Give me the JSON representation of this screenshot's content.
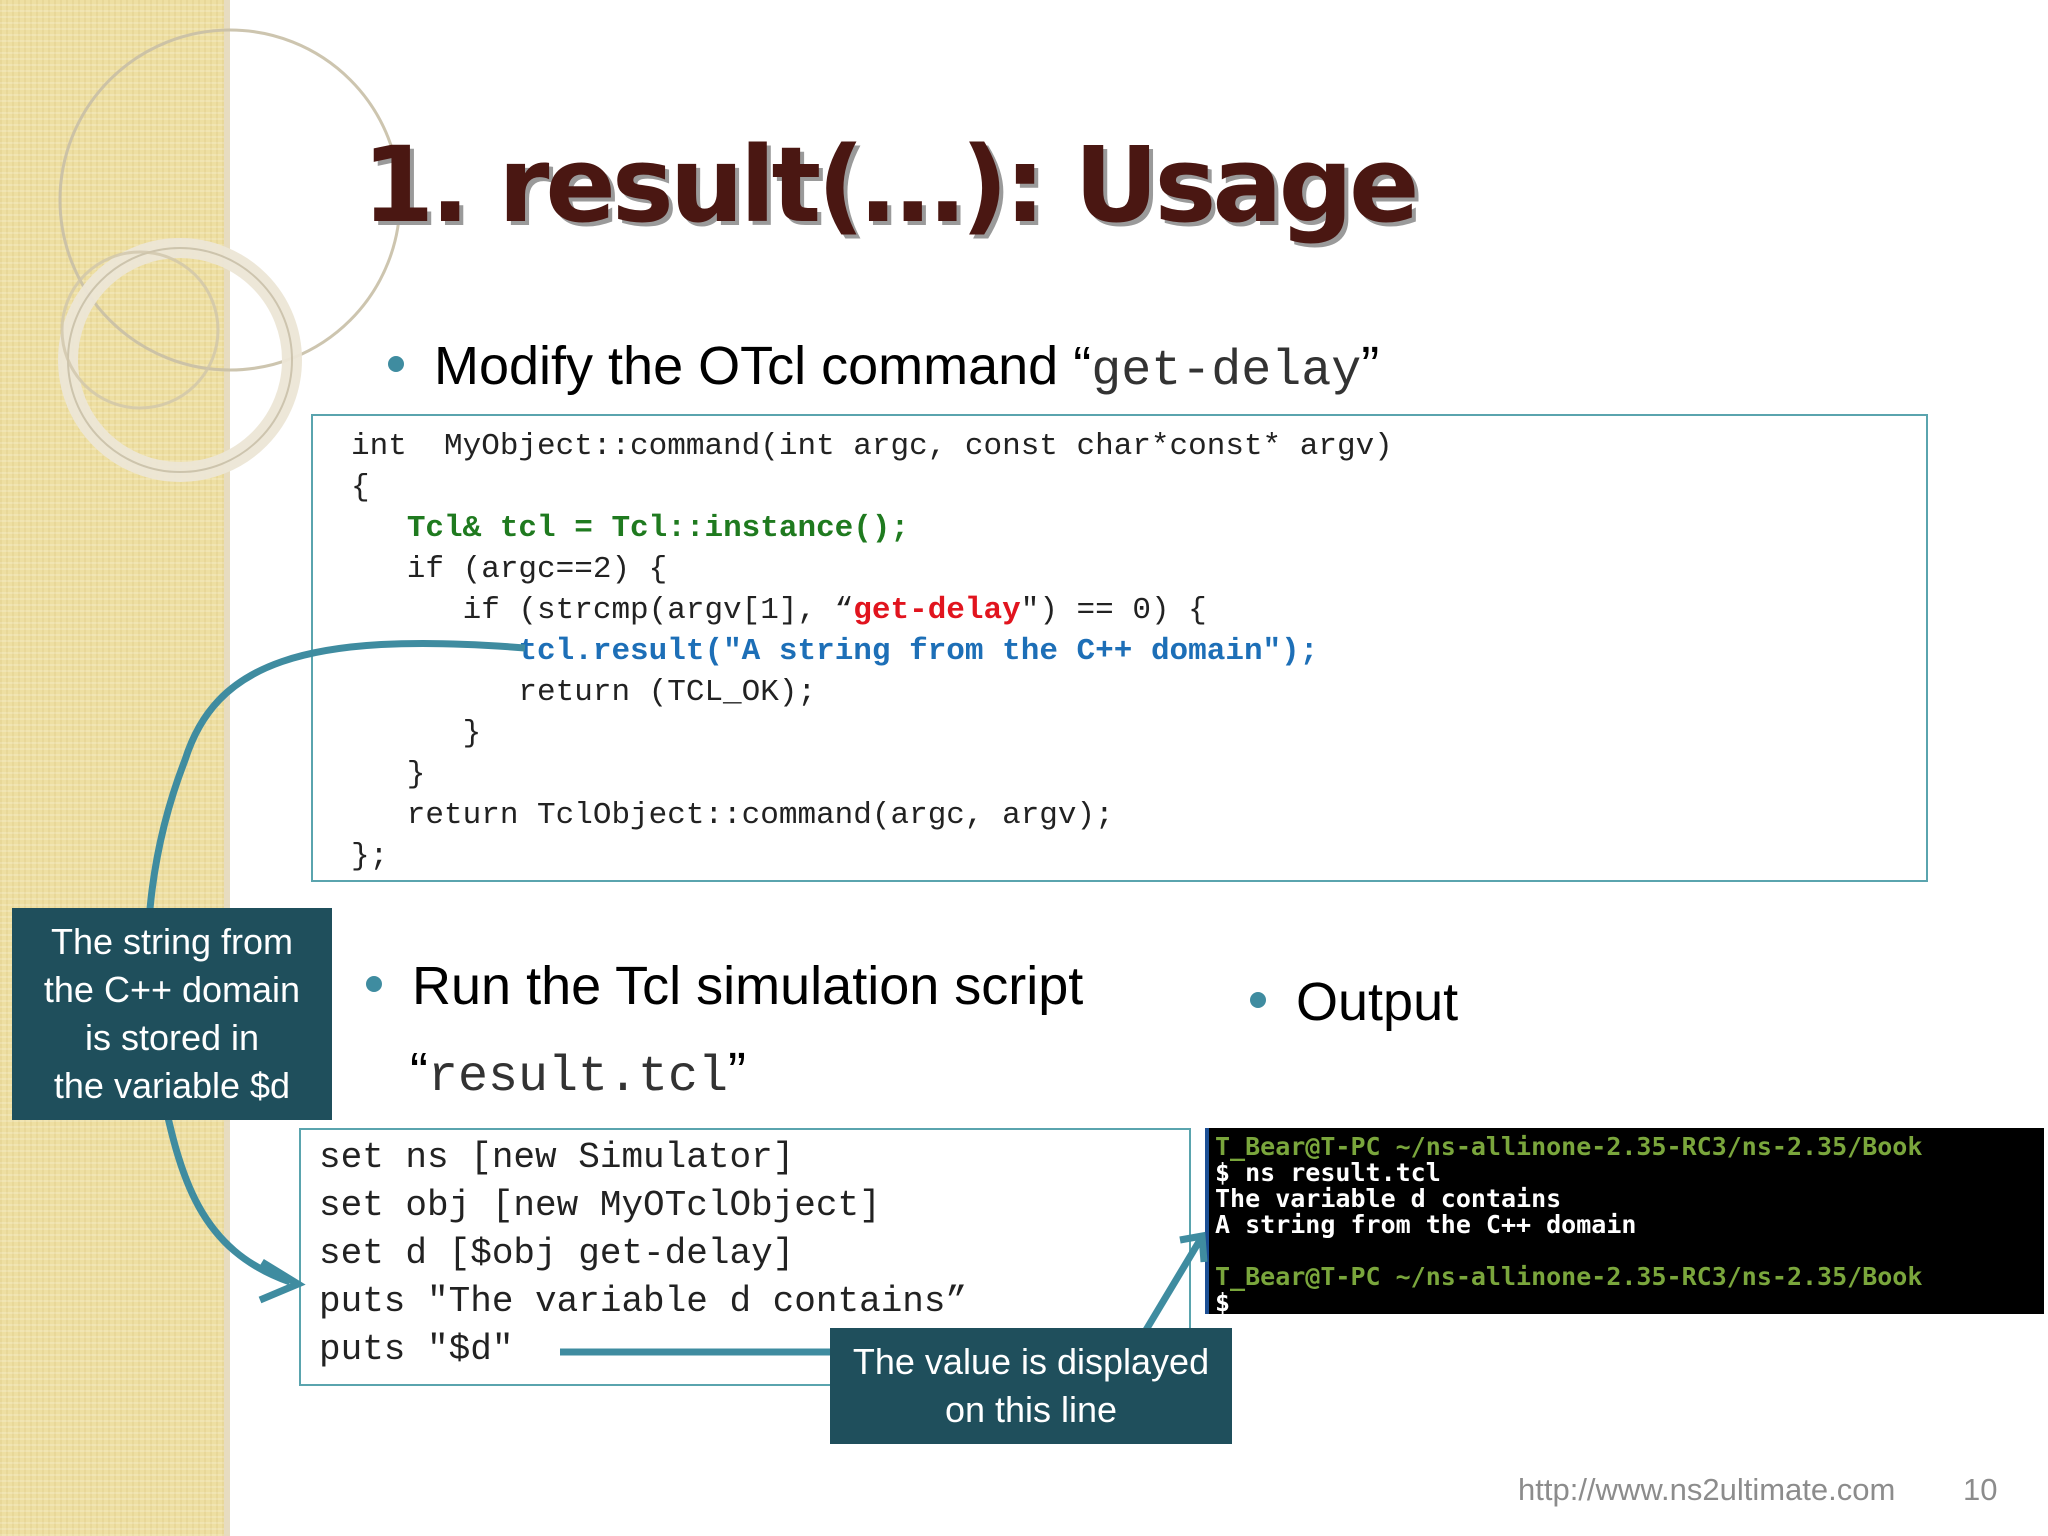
{
  "slide": {
    "title": "1. result(…): Usage"
  },
  "bullets": {
    "modify": {
      "prefix": "Modify the OTcl command “",
      "code": "get-delay",
      "suffix": "”"
    },
    "run": {
      "line1": "Run the Tcl simulation script",
      "open": "“",
      "code": "result.tcl",
      "close": "”"
    },
    "output": "Output"
  },
  "cpp_code": {
    "line1": "int  MyObject::command(int argc, const char*const* argv)",
    "line2": "{",
    "line3_indent": "   ",
    "line3": "Tcl& tcl = Tcl::instance();",
    "line4": "   if (argc==2) {",
    "line5_pre": "      if (strcmp(argv[1], “",
    "line5_key": "get-delay",
    "line5_post": "\") == 0) {",
    "line6_indent": "         ",
    "line6": "tcl.result(\"A string from the C++ domain\");",
    "line7": "         return (TCL_OK);",
    "line8": "      }",
    "line9": "   }",
    "line10": "   return TclObject::command(argc, argv);",
    "line11": "};"
  },
  "tcl_script": {
    "lines": [
      "set ns [new Simulator]",
      "set obj [new MyOTclObject]",
      "set d [$obj get-delay]",
      "puts \"The variable d contains”",
      "puts \"$d\""
    ]
  },
  "terminal": {
    "prompt1": "T_Bear@T-PC ~/ns-allinone-2.35-RC3/ns-2.35/Book",
    "command": "$ ns result.tcl",
    "out1": "The variable d contains",
    "out2": "A string from the C++ domain",
    "prompt2": "T_Bear@T-PC ~/ns-allinone-2.35-RC3/ns-2.35/Book",
    "cursor": "$"
  },
  "callouts": {
    "left": "The string from\nthe C++ domain\nis stored in\nthe variable $d",
    "bottom": "The value is displayed\non this line"
  },
  "footer": {
    "url": "http://www.ns2ultimate.com",
    "page": "10"
  },
  "colors": {
    "title": "#4a1712",
    "accent": "#3f8ca0",
    "callout_bg": "#1f4f5c",
    "code_green": "#1f7a1f",
    "code_red": "#e1141e",
    "code_blue": "#1d6fb7"
  }
}
